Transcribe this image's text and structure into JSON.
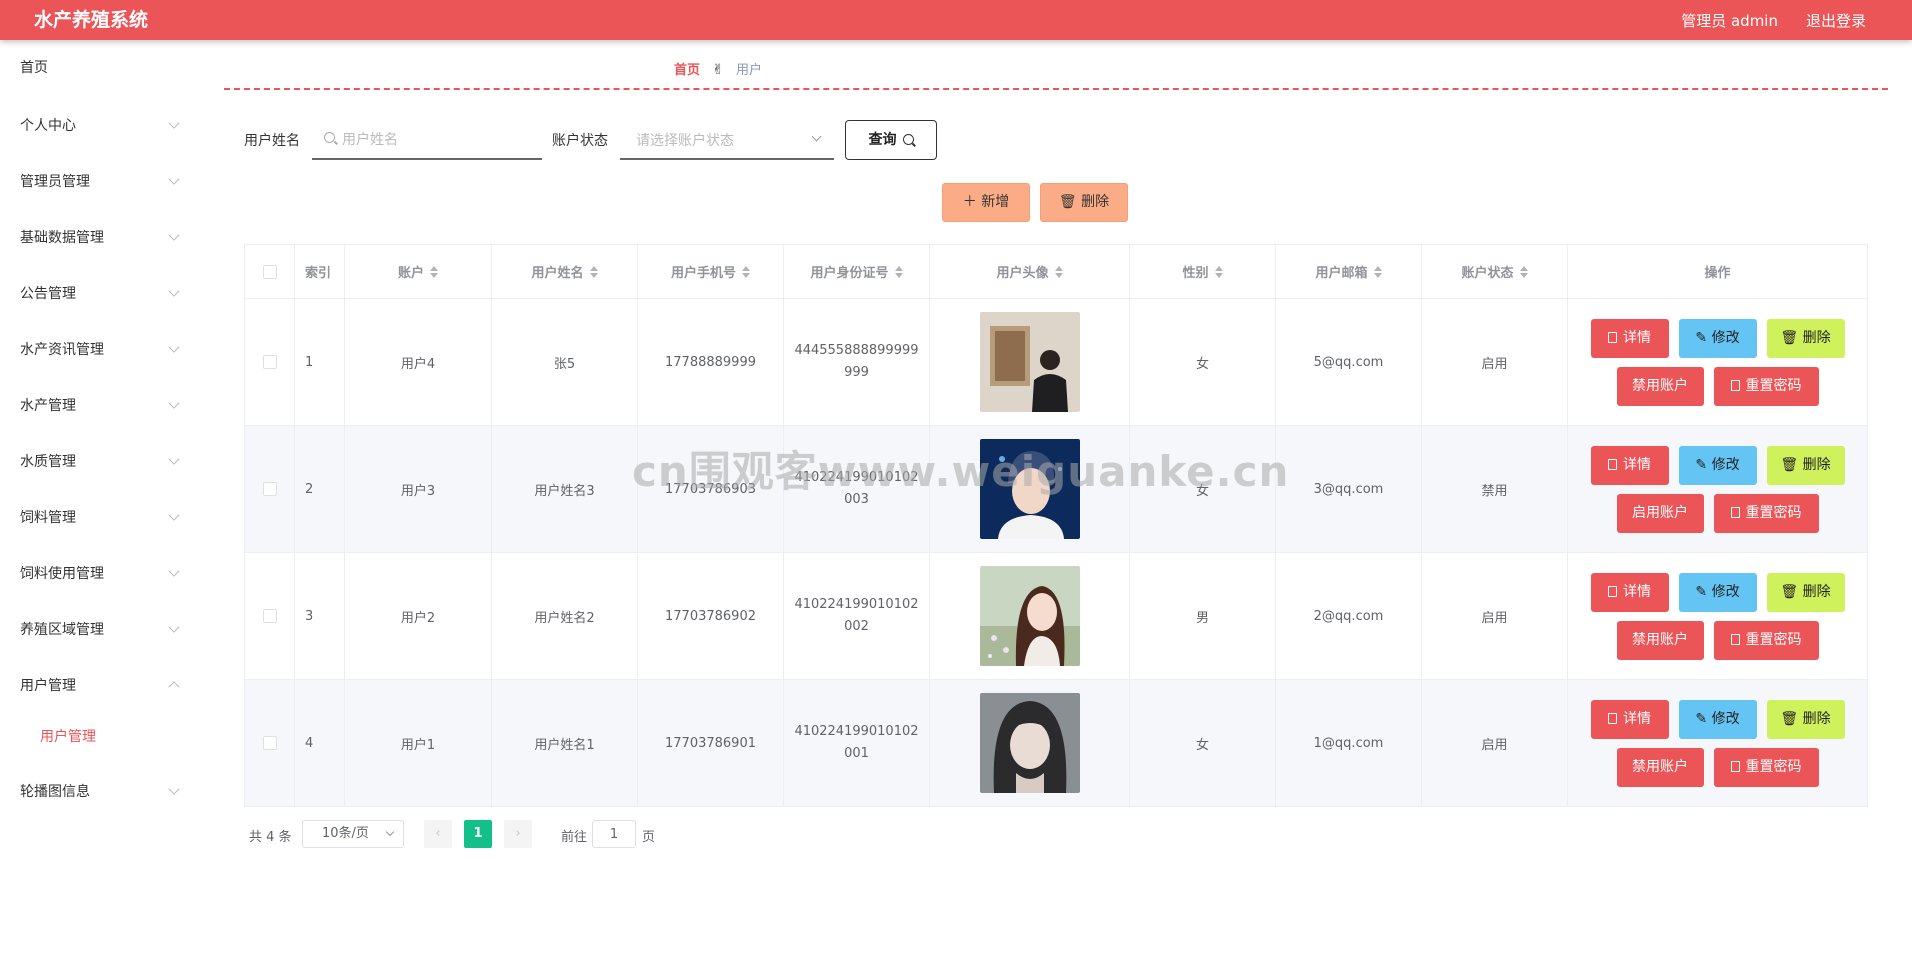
{
  "header": {
    "title": "水产养殖系统",
    "admin": "管理员 admin",
    "logout": "退出登录"
  },
  "sidebar": {
    "items": [
      {
        "label": "首页"
      },
      {
        "label": "个人中心"
      },
      {
        "label": "管理员管理"
      },
      {
        "label": "基础数据管理"
      },
      {
        "label": "公告管理"
      },
      {
        "label": "水产资讯管理"
      },
      {
        "label": "水产管理"
      },
      {
        "label": "水质管理"
      },
      {
        "label": "饲料管理"
      },
      {
        "label": "饲料使用管理"
      },
      {
        "label": "养殖区域管理"
      },
      {
        "label": "用户管理"
      },
      {
        "label": "轮播图信息"
      }
    ],
    "sub_item": "用户管理"
  },
  "breadcrumb": {
    "home": "首页",
    "sep": "✌",
    "current": "用户"
  },
  "search": {
    "name_label": "用户姓名",
    "name_placeholder": "用户姓名",
    "status_label": "账户状态",
    "status_placeholder": "请选择账户状态",
    "query": "查询"
  },
  "actions": {
    "add": "新增",
    "delete": "删除"
  },
  "table": {
    "headers": [
      "索引",
      "账户",
      "用户姓名",
      "用户手机号",
      "用户身份证号",
      "用户头像",
      "性别",
      "用户邮箱",
      "账户状态",
      "操作"
    ],
    "rows": [
      {
        "index": "1",
        "account": "用户4",
        "name": "张5",
        "phone": "17788889999",
        "idcard": "444555888899999999",
        "avatar": "portrait-man-gallery",
        "gender": "女",
        "email": "5@qq.com",
        "status": "启用",
        "toggle": "禁用账户"
      },
      {
        "index": "2",
        "account": "用户3",
        "name": "用户姓名3",
        "phone": "17703786903",
        "idcard": "410224199010102003",
        "avatar": "portrait-young-man",
        "gender": "女",
        "email": "3@qq.com",
        "status": "禁用",
        "toggle": "启用账户"
      },
      {
        "index": "3",
        "account": "用户2",
        "name": "用户姓名2",
        "phone": "17703786902",
        "idcard": "410224199010102002",
        "avatar": "portrait-girl-flowers",
        "gender": "男",
        "email": "2@qq.com",
        "status": "启用",
        "toggle": "禁用账户"
      },
      {
        "index": "4",
        "account": "用户1",
        "name": "用户姓名1",
        "phone": "17703786901",
        "idcard": "410224199010102001",
        "avatar": "portrait-girl-bangs",
        "gender": "女",
        "email": "1@qq.com",
        "status": "启用",
        "toggle": "禁用账户"
      }
    ],
    "op_labels": {
      "detail": "详情",
      "edit": "修改",
      "delete": "删除",
      "reset": "重置密码"
    }
  },
  "pagination": {
    "total": "共 4 条",
    "page_size": "10条/页",
    "current": "1",
    "goto": "前往",
    "goto_value": "1",
    "page_unit": "页"
  },
  "watermark": "cn围观客www.weiguanke.cn",
  "colors": {
    "brand": "#ec5558",
    "edit": "#64c4f4",
    "delete": "#cff15c",
    "add": "#fbac86",
    "page_active": "#13c08a"
  }
}
